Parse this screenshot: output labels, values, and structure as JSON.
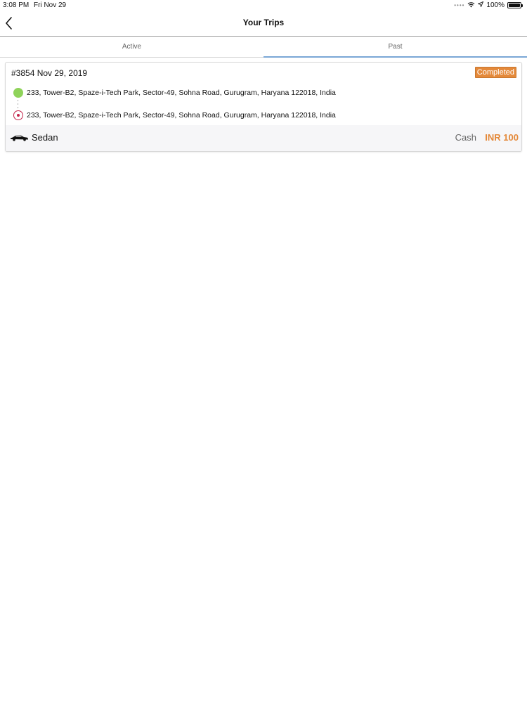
{
  "status_bar": {
    "time": "3:08 PM",
    "date": "Fri Nov 29",
    "battery_text": "100%",
    "battery_level": 1.0,
    "signal_icon": "cellular-dots-icon",
    "wifi_icon": "wifi-icon",
    "location_icon": "location-arrow-icon"
  },
  "nav": {
    "title": "Your Trips",
    "back_icon": "chevron-left-icon"
  },
  "tabs": [
    {
      "label": "Active",
      "selected": false
    },
    {
      "label": "Past",
      "selected": true
    }
  ],
  "trip": {
    "id_date": "#3854 Nov 29, 2019",
    "status": "Completed",
    "pickup": "233, Tower-B2, Spaze-i-Tech Park, Sector-49, Sohna Road, Gurugram, Haryana 122018, India",
    "drop": "233, Tower-B2, Spaze-i-Tech Park, Sector-49, Sohna Road, Gurugram, Haryana 122018, India",
    "car_icon": "sedan-car-icon",
    "car_type": "Sedan",
    "payment": "Cash",
    "fare": "INR 100"
  },
  "colors": {
    "accent": "#e4893a",
    "pickup": "#8fd35a",
    "drop": "#c4234a",
    "tab_indicator": "#7aa7d6"
  }
}
